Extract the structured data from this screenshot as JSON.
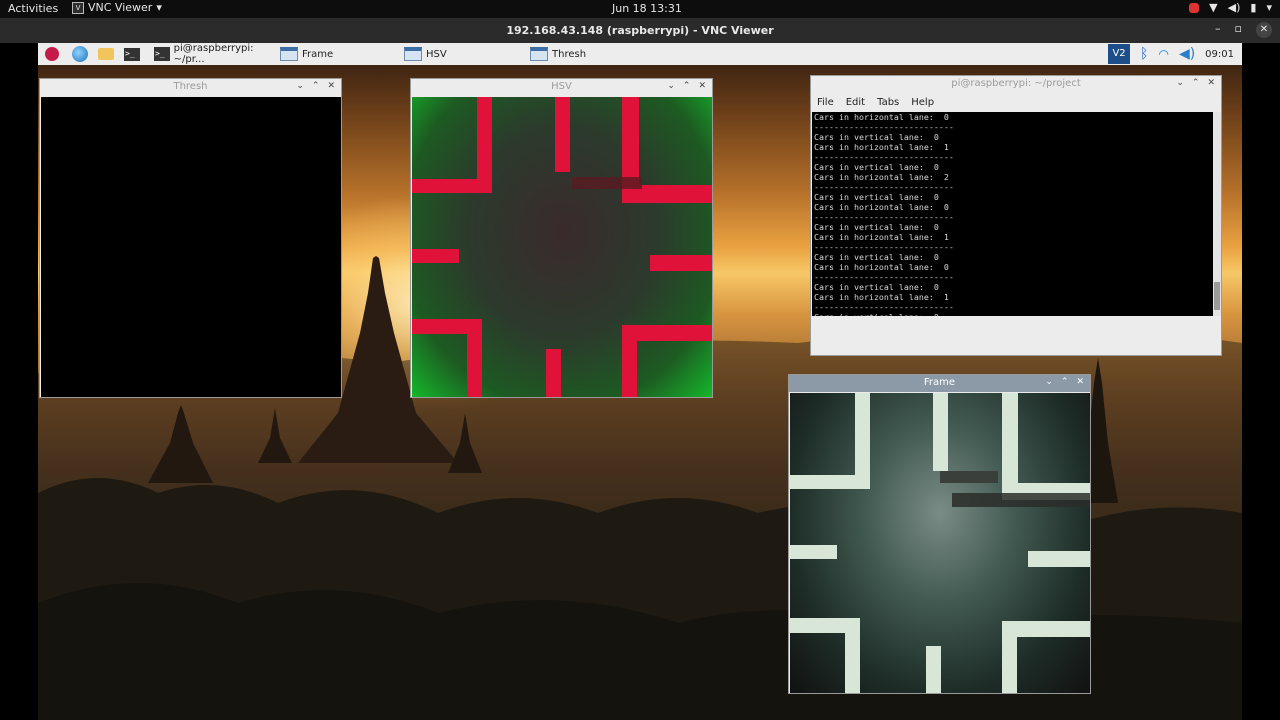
{
  "gnome": {
    "activities": "Activities",
    "app_menu": "VNC Viewer",
    "clock": "Jun 18  13:31"
  },
  "vnc": {
    "title": "192.168.43.148 (raspberrypi) - VNC Viewer"
  },
  "pi": {
    "tasks": [
      {
        "label": "pi@raspberrypi: ~/pr..."
      },
      {
        "label": "Frame"
      },
      {
        "label": "HSV"
      },
      {
        "label": "Thresh"
      }
    ],
    "time": "09:01",
    "vnc_icon": "V2"
  },
  "windows": {
    "thresh_title": "Thresh",
    "hsv_title": "HSV",
    "frame_title": "Frame",
    "terminal_title": "pi@raspberrypi: ~/project"
  },
  "terminal": {
    "menu": [
      "File",
      "Edit",
      "Tabs",
      "Help"
    ],
    "lines": [
      "Cars in horizontal lane:  0",
      "----------------------------",
      "Cars in vertical lane:  0",
      "Cars in horizontal lane:  1",
      "----------------------------",
      "Cars in vertical lane:  0",
      "Cars in horizontal lane:  2",
      "----------------------------",
      "Cars in vertical lane:  0",
      "Cars in horizontal lane:  0",
      "----------------------------",
      "Cars in vertical lane:  0",
      "Cars in horizontal lane:  1",
      "----------------------------",
      "Cars in vertical lane:  0",
      "Cars in horizontal lane:  0",
      "----------------------------",
      "Cars in vertical lane:  0",
      "Cars in horizontal lane:  1",
      "----------------------------",
      "Cars in vertical lane:  0",
      "Cars in horizontal lane:  0",
      "----------------------------"
    ]
  },
  "colors": {
    "hsv_stripe": "#e0123a",
    "frame_stripe": "#d8e6d8"
  }
}
